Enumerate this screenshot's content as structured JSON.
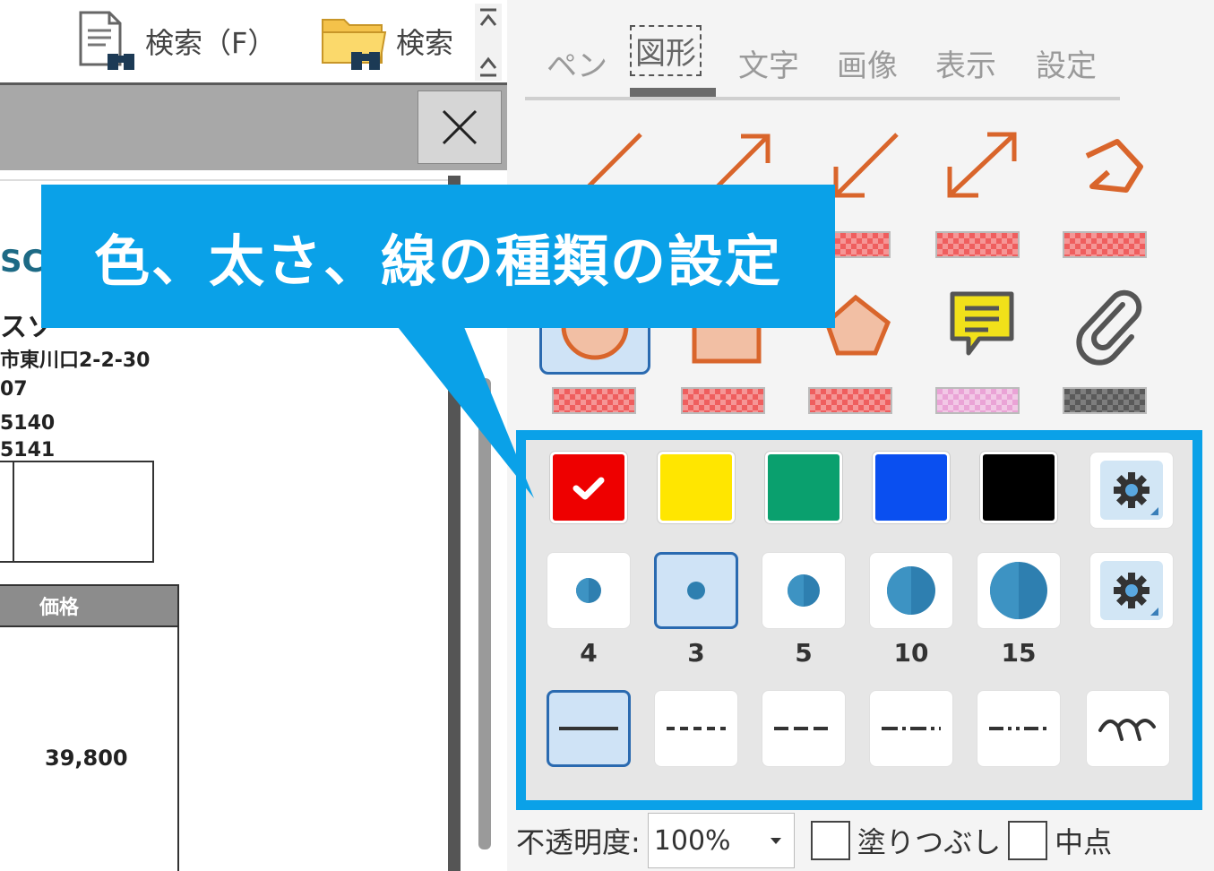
{
  "toolbar": {
    "search_file_label": "検索（F）",
    "search_folder_label": "検索"
  },
  "document": {
    "logo_fragment": "SC",
    "line1": "スソ",
    "line2": "市東川口2-2-30",
    "line3": "07",
    "line4": "5140",
    "line5": "5141",
    "table_header": "価格",
    "price": "39,800"
  },
  "tabs": [
    "ペン",
    "図形",
    "文字",
    "画像",
    "表示",
    "設定"
  ],
  "active_tab": "図形",
  "callout": {
    "text": "色、太さ、線の種類の設定"
  },
  "line_widths": [
    "4",
    "3",
    "5",
    "10",
    "15"
  ],
  "bottom": {
    "opacity_label": "不透明度:",
    "opacity_value": "100%",
    "fill_label": "塗りつぶし",
    "midpoint_label": "中点"
  },
  "colors": {
    "accent": "#0aa1e8",
    "shape_orange": "#d9652b",
    "selected_blue": "#2a6ab0",
    "color_red": "#ee0000",
    "color_yellow": "#ffe600",
    "color_green": "#0aa06e",
    "color_blue": "#0a4ff0",
    "color_black": "#000000"
  }
}
